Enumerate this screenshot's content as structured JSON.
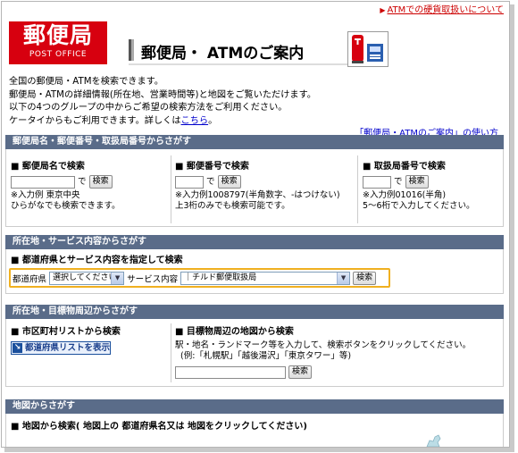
{
  "header": {
    "top_link": "ATMでの硬貨取扱いについて",
    "logo_main": "郵便局",
    "logo_sub": "POST OFFICE",
    "page_title": "郵便局・ ATMのご案内"
  },
  "intro": {
    "line1": "全国の郵便局・ATMを検索できます。",
    "line2": "郵便局・ATMの詳細情報(所在地、営業時間等)と地図をご覧いただけます。",
    "line3": "以下の4つのグループの中からご希望の検索方法をご利用ください。",
    "line4_prefix": "ケータイからもご利用できます。詳しくは",
    "line4_link": "こちら",
    "line4_suffix": "。",
    "howto_link": "「郵便局・ATMのご案内」の使い方"
  },
  "section1": {
    "header": "郵便局名・郵便番号・取扱局番号からさがす",
    "col1": {
      "heading": "■ 郵便局名で検索",
      "suffix": "で",
      "button": "検索",
      "note1": "※入力例 東京中央",
      "note2": "ひらがなでも検索できます。"
    },
    "col2": {
      "heading": "■ 郵便番号で検索",
      "suffix": "で",
      "button": "検索",
      "note1": "※入力例1008797(半角数字、-はつけない)",
      "note2": "上3桁のみでも検索可能です。"
    },
    "col3": {
      "heading": "■ 取扱局番号で検索",
      "suffix": "で",
      "button": "検索",
      "note1": "※入力例01016(半角)",
      "note2": "5〜6桁で入力してください。"
    }
  },
  "section2": {
    "header": "所在地・サービス内容からさがす",
    "heading": "■ 都道府県とサービス内容を指定して検索",
    "pref_label": "都道府県",
    "pref_value": "選択してください",
    "service_label": "サービス内容",
    "service_value": "｜チルド郵便取扱局",
    "button": "検索"
  },
  "section3": {
    "header": "所在地・目標物周辺からさがす",
    "left_heading": "■ 市区町村リストから検索",
    "left_button": "都道府県リストを表示",
    "right_heading": "■ 目標物周辺の地図から検索",
    "right_text1": "駅・地名・ランドマーク等を入力して、検索ボタンをクリックしてください。",
    "right_text2": "(例:「札幌駅」「越後湯沢」「東京タワー」等)",
    "right_button": "検索"
  },
  "section4": {
    "header": "地図からさがす",
    "heading": "■ 地図から検索( 地図上の 都道府県名又は 地図をクリックしてください)"
  },
  "colors": {
    "brand_red": "#d7000f",
    "section_header": "#5a6c89",
    "highlight": "#f0b020",
    "link_blue": "#0000cc"
  }
}
